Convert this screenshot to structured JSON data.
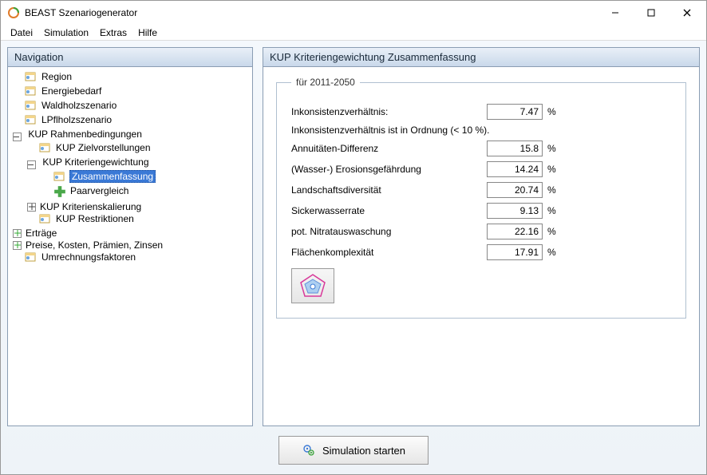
{
  "app": {
    "title": "BEAST Szenariogenerator"
  },
  "menu": {
    "items": [
      "Datei",
      "Simulation",
      "Extras",
      "Hilfe"
    ]
  },
  "nav": {
    "title": "Navigation",
    "items": {
      "region": "Region",
      "energiebedarf": "Energiebedarf",
      "waldholz": "Waldholzszenario",
      "lpflholz": "LPflholzszenario",
      "kup_rahmen": "KUP Rahmenbedingungen",
      "kup_ziel": "KUP Zielvorstellungen",
      "kup_gewicht": "KUP Kriteriengewichtung",
      "zusammenfassung": "Zusammenfassung",
      "paarvergleich": "Paarvergleich",
      "kup_skalierung": "KUP Kriterienskalierung",
      "kup_restrikt": "KUP Restriktionen",
      "ertraege": "Erträge",
      "preise": "Preise, Kosten, Prämien, Zinsen",
      "umrechnung": "Umrechnungsfaktoren"
    }
  },
  "main": {
    "title": "KUP Kriteriengewichtung Zusammenfassung",
    "period_legend": "für 2011-2050",
    "labels": {
      "inkons": "Inkonsistenzverhältnis:",
      "inkons_ok": "Inkonsistenzverhältnis ist in Ordnung (< 10 %).",
      "annu": "Annuitäten-Differenz",
      "erosion": "(Wasser-) Erosionsgefährdung",
      "landdiv": "Landschaftsdiversität",
      "sicker": "Sickerwasserrate",
      "nitrat": "pot. Nitratauswaschung",
      "flaechen": "Flächenkomplexität"
    },
    "values": {
      "inkons": "7.47",
      "annu": "15.8",
      "erosion": "14.24",
      "landdiv": "20.74",
      "sicker": "9.13",
      "nitrat": "22.16",
      "flaechen": "17.91"
    },
    "unit": "%"
  },
  "buttons": {
    "simulate": "Simulation starten"
  }
}
